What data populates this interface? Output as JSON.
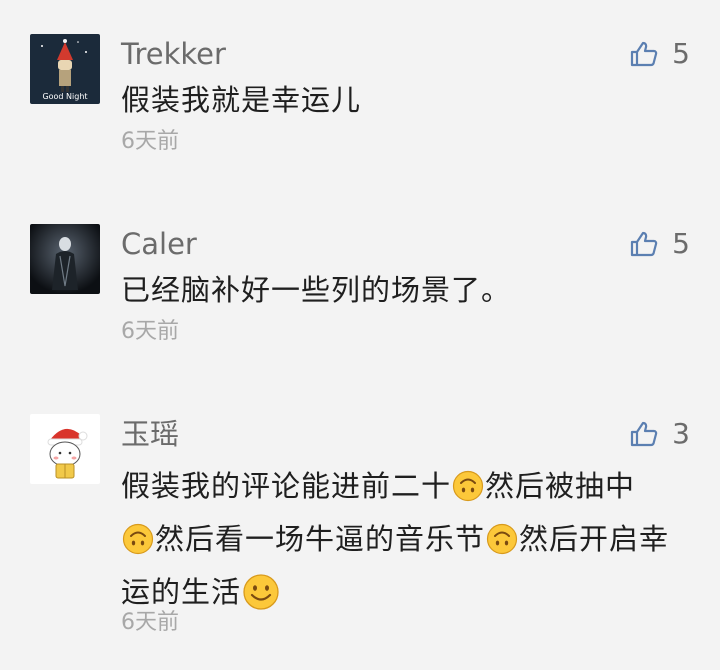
{
  "comments": [
    {
      "username": "Trekker",
      "likes": "5",
      "text": "假装我就是幸运儿",
      "time": "6天前",
      "avatar_caption": "Good Night"
    },
    {
      "username": "Caler",
      "likes": "5",
      "text": "已经脑补好一些列的场景了。",
      "time": "6天前"
    },
    {
      "username": "玉瑶",
      "likes": "3",
      "text_parts": [
        "假装我的评论能进前二十",
        "然后被抽中",
        "然后看一场牛逼的音乐节",
        "然后开启幸运的生活"
      ],
      "time": "6天前"
    }
  ],
  "icons": {
    "like": "thumbs-up-icon",
    "emoji_upside_down": "upside-down-face-icon",
    "emoji_smile": "smiling-face-icon"
  },
  "colors": {
    "background": "#f3f3f3",
    "username": "#6b6b6b",
    "text": "#1f1f1f",
    "time": "#a8a8a8",
    "like_icon": "#5b7fb1"
  }
}
